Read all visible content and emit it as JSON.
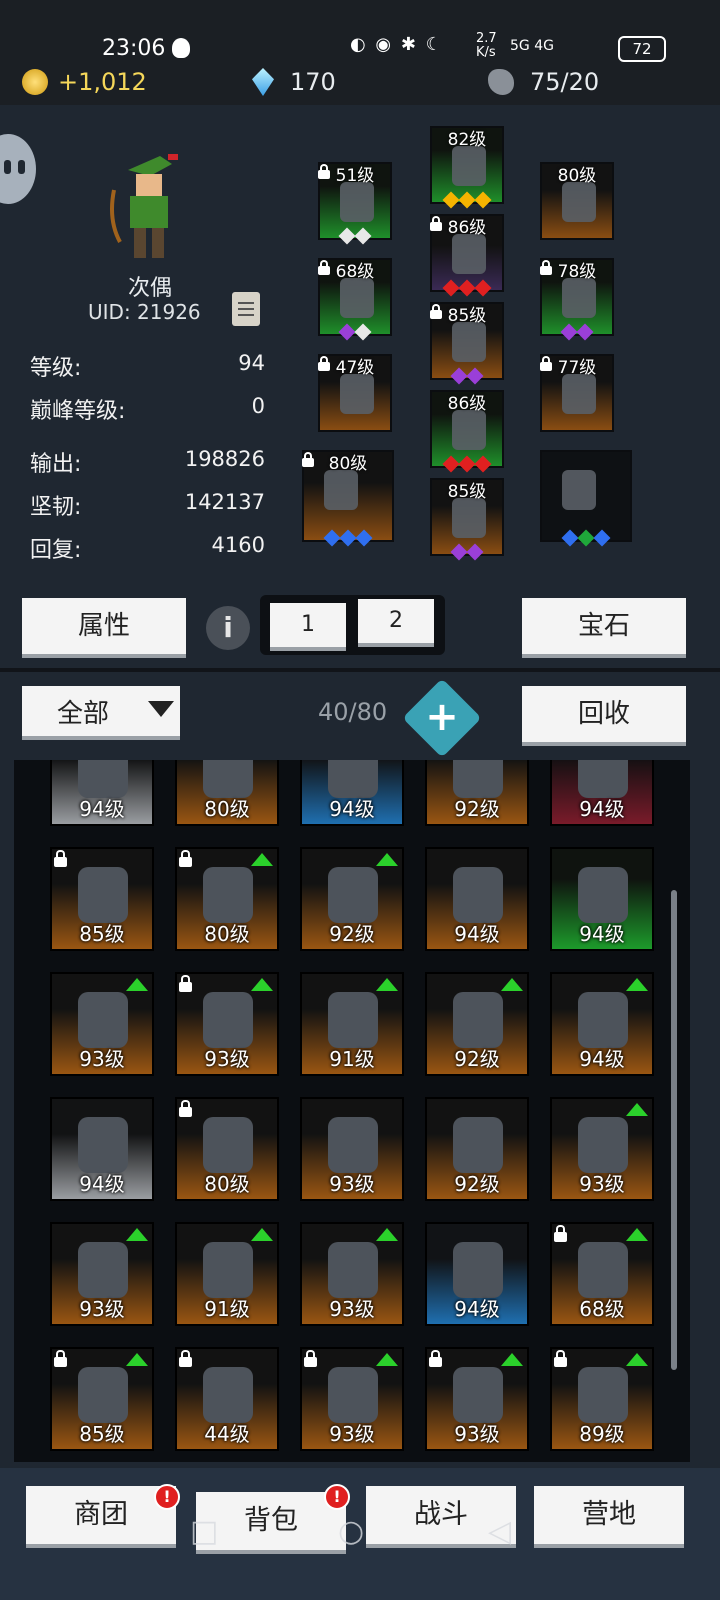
{
  "status_bar": {
    "time": "23:06",
    "net_speed": "2.7 K/s",
    "network": "5G 4G",
    "battery": "72"
  },
  "resources": {
    "gold": "+1,012",
    "gems": "170",
    "stones": "75/20"
  },
  "character": {
    "name": "次偶",
    "uid": "UID: 21926"
  },
  "stats": [
    {
      "label": "等级:",
      "value": "94"
    },
    {
      "label": "巅峰等级:",
      "value": "0"
    },
    {
      "label": "输出:",
      "value": "198826"
    },
    {
      "label": "坚韧:",
      "value": "142137"
    },
    {
      "label": "回复:",
      "value": "4160"
    }
  ],
  "equipment": [
    {
      "level": "51级",
      "quality": "green",
      "locked": true,
      "gems": [
        "white",
        "white"
      ]
    },
    {
      "level": "82级",
      "quality": "green",
      "locked": false,
      "gems": [
        "yellow",
        "yellow",
        "yellow"
      ]
    },
    {
      "level": "80级",
      "quality": "orange",
      "locked": false,
      "gems": []
    },
    {
      "level": "68级",
      "quality": "green",
      "locked": true,
      "gems": [
        "purple",
        "white"
      ]
    },
    {
      "level": "86级",
      "quality": "purple",
      "locked": true,
      "gems": [
        "red",
        "red",
        "red"
      ]
    },
    {
      "level": "78级",
      "quality": "green",
      "locked": true,
      "gems": [
        "purple",
        "purple"
      ]
    },
    {
      "level": "47级",
      "quality": "orange",
      "locked": true,
      "gems": []
    },
    {
      "level": "85级",
      "quality": "orange",
      "locked": true,
      "gems": [
        "purple",
        "purple"
      ]
    },
    {
      "level": "77级",
      "quality": "orange",
      "locked": true,
      "gems": []
    },
    {
      "level": "86级",
      "quality": "green",
      "locked": false,
      "gems": [
        "red",
        "red",
        "red"
      ]
    },
    {
      "level": "80级",
      "quality": "orange",
      "locked": true,
      "gems": [
        "blue",
        "blue",
        "blue"
      ]
    },
    {
      "level": "85级",
      "quality": "orange",
      "locked": false,
      "gems": [
        "purple",
        "purple"
      ]
    },
    {
      "level": "",
      "quality": "dark",
      "locked": false,
      "gems": [
        "blue",
        "green",
        "blue"
      ]
    }
  ],
  "buttons": {
    "attributes": "属性",
    "info": "i",
    "tab1": "1",
    "tab2": "2",
    "gems": "宝石",
    "filter": "全部",
    "recycle": "回收"
  },
  "inventory": {
    "count": "40/80",
    "items": [
      {
        "level": "94级",
        "bg": "white",
        "locked": false,
        "up": false
      },
      {
        "level": "80级",
        "bg": "orange",
        "locked": false,
        "up": false
      },
      {
        "level": "94级",
        "bg": "blue",
        "locked": false,
        "up": false
      },
      {
        "level": "92级",
        "bg": "orange",
        "locked": false,
        "up": false
      },
      {
        "level": "94级",
        "bg": "red",
        "locked": false,
        "up": false
      },
      {
        "level": "85级",
        "bg": "orange",
        "locked": true,
        "up": false
      },
      {
        "level": "80级",
        "bg": "orange",
        "locked": true,
        "up": true
      },
      {
        "level": "92级",
        "bg": "orange",
        "locked": false,
        "up": true
      },
      {
        "level": "94级",
        "bg": "orange",
        "locked": false,
        "up": false
      },
      {
        "level": "94级",
        "bg": "green",
        "locked": false,
        "up": false
      },
      {
        "level": "93级",
        "bg": "orange",
        "locked": false,
        "up": true
      },
      {
        "level": "93级",
        "bg": "orange",
        "locked": true,
        "up": true
      },
      {
        "level": "91级",
        "bg": "orange",
        "locked": false,
        "up": true
      },
      {
        "level": "92级",
        "bg": "orange",
        "locked": false,
        "up": true
      },
      {
        "level": "94级",
        "bg": "orange",
        "locked": false,
        "up": true
      },
      {
        "level": "94级",
        "bg": "white",
        "locked": false,
        "up": false
      },
      {
        "level": "80级",
        "bg": "orange",
        "locked": true,
        "up": false
      },
      {
        "level": "93级",
        "bg": "orange",
        "locked": false,
        "up": false
      },
      {
        "level": "92级",
        "bg": "orange",
        "locked": false,
        "up": false
      },
      {
        "level": "93级",
        "bg": "orange",
        "locked": false,
        "up": true
      },
      {
        "level": "93级",
        "bg": "orange",
        "locked": false,
        "up": true
      },
      {
        "level": "91级",
        "bg": "orange",
        "locked": false,
        "up": true
      },
      {
        "level": "93级",
        "bg": "orange",
        "locked": false,
        "up": true
      },
      {
        "level": "94级",
        "bg": "blue",
        "locked": false,
        "up": false
      },
      {
        "level": "68级",
        "bg": "orange",
        "locked": true,
        "up": true
      },
      {
        "level": "85级",
        "bg": "orange",
        "locked": true,
        "up": true
      },
      {
        "level": "44级",
        "bg": "orange",
        "locked": true,
        "up": false
      },
      {
        "level": "93级",
        "bg": "orange",
        "locked": true,
        "up": true
      },
      {
        "level": "93级",
        "bg": "orange",
        "locked": true,
        "up": true
      },
      {
        "level": "89级",
        "bg": "orange",
        "locked": true,
        "up": true
      }
    ]
  },
  "bottom_nav": [
    {
      "label": "商团",
      "badge": "!"
    },
    {
      "label": "背包",
      "badge": "!"
    },
    {
      "label": "战斗",
      "badge": ""
    },
    {
      "label": "营地",
      "badge": ""
    }
  ],
  "colors": {
    "accent": "#3aa2b5",
    "upgrade": "#2bd12b",
    "badge": "#e02020"
  }
}
